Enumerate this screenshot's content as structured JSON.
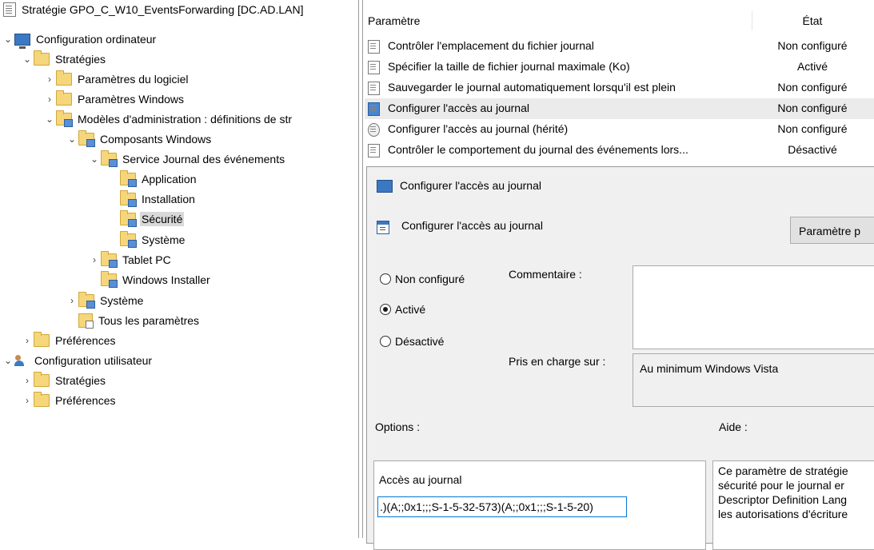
{
  "tree": {
    "root": "Stratégie GPO_C_W10_EventsForwarding [DC.AD.LAN]",
    "items": [
      {
        "label": "Configuration ordinateur"
      },
      {
        "label": "Stratégies"
      },
      {
        "label": "Paramètres du logiciel"
      },
      {
        "label": "Paramètres Windows"
      },
      {
        "label": "Modèles d'administration : définitions de str"
      },
      {
        "label": "Composants Windows"
      },
      {
        "label": "Service Journal des événements"
      },
      {
        "label": "Application"
      },
      {
        "label": "Installation"
      },
      {
        "label": "Sécurité"
      },
      {
        "label": "Système"
      },
      {
        "label": "Tablet PC"
      },
      {
        "label": "Windows Installer"
      },
      {
        "label": "Système"
      },
      {
        "label": "Tous les paramètres"
      },
      {
        "label": "Préférences"
      },
      {
        "label": "Configuration utilisateur"
      },
      {
        "label": "Stratégies"
      },
      {
        "label": "Préférences"
      }
    ]
  },
  "list": {
    "col_setting": "Paramètre",
    "col_state": "État",
    "rows": [
      {
        "name": "Contrôler l'emplacement du fichier journal",
        "state": "Non configuré"
      },
      {
        "name": "Spécifier la taille de fichier journal maximale (Ko)",
        "state": "Activé"
      },
      {
        "name": "Sauvegarder le journal automatiquement lorsqu'il est plein",
        "state": "Non configuré"
      },
      {
        "name": "Configurer l'accès au journal",
        "state": "Non configuré"
      },
      {
        "name": "Configurer l'accès au journal (hérité)",
        "state": "Non configuré"
      },
      {
        "name": "Contrôler le comportement du journal des événements lors...",
        "state": "Désactivé"
      }
    ]
  },
  "dialog": {
    "title": "Configurer l'accès au journal",
    "subtitle": "Configurer l'accès au journal",
    "next_button": "Paramètre p",
    "radio_not_configured": "Non configuré",
    "radio_enabled": "Activé",
    "radio_disabled": "Désactivé",
    "selected": "Activé",
    "comment_label": "Commentaire :",
    "comment_value": "",
    "supported_label": "Pris en charge sur :",
    "supported_value": "Au minimum Windows Vista",
    "options_label": "Options :",
    "help_label": "Aide :",
    "option_field_label": "Accès au journal",
    "option_field_value": ".)(A;;0x1;;;S-1-5-32-573)(A;;0x1;;;S-1-5-20)",
    "help_lines": [
      "Ce paramètre de stratégie",
      "sécurité pour le journal er",
      "Descriptor Definition Lang",
      "les autorisations d'écriture"
    ]
  }
}
